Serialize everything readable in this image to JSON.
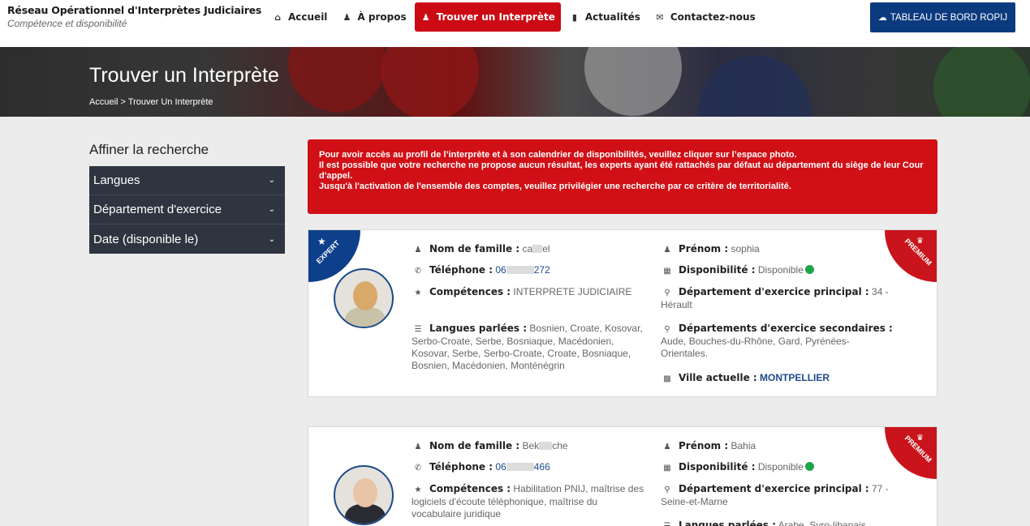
{
  "header": {
    "brand_title": "Réseau Opérationnel d'Interprètes Judiciaires",
    "brand_subtitle": "Compétence et disponibilité",
    "nav": [
      {
        "label": "Accueil",
        "icon": "home-icon"
      },
      {
        "label": "À propos",
        "icon": "users-icon"
      },
      {
        "label": "Trouver un Interprète",
        "icon": "user-icon"
      },
      {
        "label": "Actualités",
        "icon": "book-icon"
      },
      {
        "label": "Contactez-nous",
        "icon": "envelope-icon"
      }
    ],
    "dashboard_button": "TABLEAU DE BORD ROPIJ"
  },
  "banner": {
    "title": "Trouver un Interprète",
    "breadcrumb": "Accueil > Trouver Un Interprète"
  },
  "sidebar": {
    "title": "Affiner la recherche",
    "filters": [
      "Langues",
      "Département d'exercice",
      "Date (disponible le)"
    ]
  },
  "alert": {
    "lines": [
      "Pour avoir accès au profil de l’interprète et à son calendrier de disponibilités, veuillez cliquer sur l’espace photo.",
      "Il est possible que votre recherche ne propose aucun résultat, les experts ayant été rattachés par défaut au département du siège de leur Cour d'appel.",
      "Jusqu'à l'activation de l'ensemble des comptes, veuillez privilégier une recherche par ce critère de territorialité."
    ]
  },
  "cards": [
    {
      "badge_left": "EXPERT",
      "badge_right": "PREMIUM",
      "nom_label": "Nom de famille :",
      "nom_value_start": "ca",
      "nom_value_end": "el",
      "tel_label": "Téléphone :",
      "tel_start": "06",
      "tel_end": "272",
      "comp_label": "Compétences :",
      "comp_value": "INTERPRETE JUDICIAIRE",
      "langues_label": "Langues parlées :",
      "langues_value": "Bosnien, Croate, Kosovar, Serbo-Croate, Serbe, Bosniaque, Macédonien, Kosovar, Serbe, Serbo-Croate, Croate, Bosniaque, Bosnien, Macédonien, Monténégrin",
      "prenom_label": "Prénom :",
      "prenom_value": "sophia",
      "dispo_label": "Disponibilité :",
      "dispo_value": "Disponible",
      "dept_label": "Département d'exercice principal :",
      "dept_value": "34 - Hérault",
      "dept2_label": "Départements d'exercice secondaires :",
      "dept2_value": "Aude, Bouches-du-Rhône, Gard, Pyrénées-Orientales.",
      "ville_label": "Ville actuelle :",
      "ville_value": "MONTPELLIER",
      "status_color": "#1fa44a"
    },
    {
      "badge_right": "PREMIUM",
      "nom_label": "Nom de famille :",
      "nom_value_start": "Bek",
      "nom_value_end": "che",
      "tel_label": "Téléphone :",
      "tel_start": "06",
      "tel_end": "466",
      "comp_label": "Compétences :",
      "comp_value": "Habilitation PNIJ, maîtrise des logiciels d'écoute téléphonique, maîtrise du vocabulaire juridique",
      "prenom_label": "Prénom :",
      "prenom_value": "Bahia",
      "dispo_label": "Disponibilité :",
      "dispo_value": "Disponible",
      "dept_label": "Département d'exercice principal :",
      "dept_value": "77 - Seine-et-Marne",
      "langues_label": "Langues parlées :",
      "langues_value": "Arabe, Syro-libanais"
    }
  ],
  "colors": {
    "primary_red": "#cc0a14",
    "navy": "#0c3a7e",
    "sidebar_bg": "#2e3540",
    "available_green": "#1fa44a"
  }
}
